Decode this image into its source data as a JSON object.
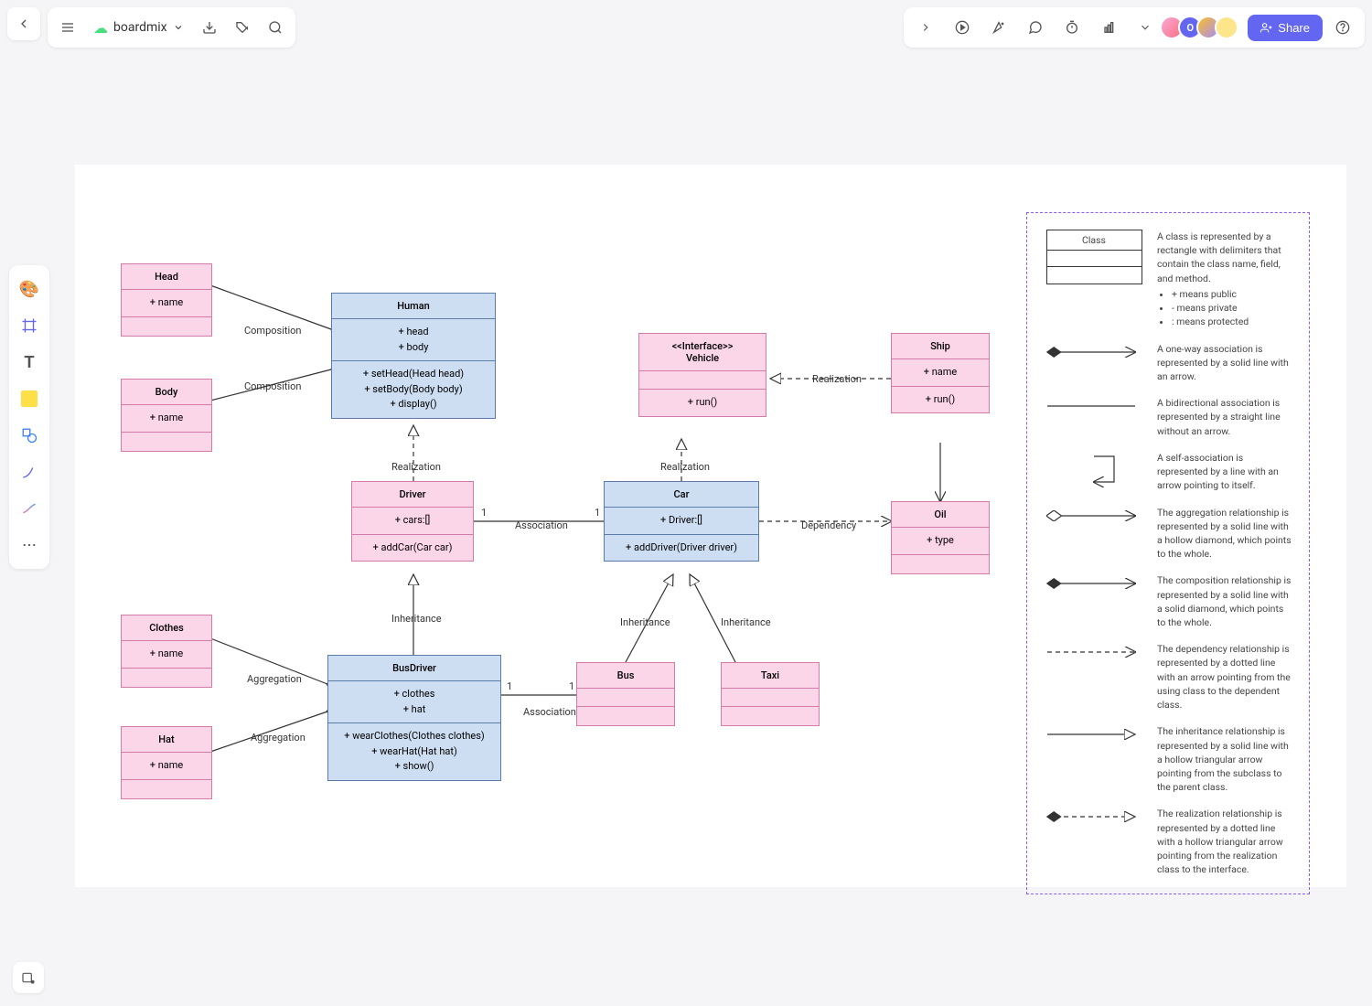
{
  "header": {
    "doc_title": "boardmix",
    "share_label": "Share",
    "avatar_letter": "O"
  },
  "classes": {
    "head": {
      "title": "Head",
      "attrs": [
        "+ name"
      ]
    },
    "body": {
      "title": "Body",
      "attrs": [
        "+ name"
      ]
    },
    "human": {
      "title": "Human",
      "attrs": [
        "+ head",
        "+ body"
      ],
      "ops": [
        "+ setHead(Head head)",
        "+ setBody(Body body)",
        "+ display()"
      ]
    },
    "driver": {
      "title": "Driver",
      "attrs": [
        "+ cars:[]"
      ],
      "ops": [
        "+ addCar(Car car)"
      ]
    },
    "busdriver": {
      "title": "BusDriver",
      "attrs": [
        "+ clothes",
        "+ hat"
      ],
      "ops": [
        "+ wearClothes(Clothes clothes)",
        "+ wearHat(Hat hat)",
        "+ show()"
      ]
    },
    "clothes": {
      "title": "Clothes",
      "attrs": [
        "+ name"
      ]
    },
    "hat": {
      "title": "Hat",
      "attrs": [
        "+ name"
      ]
    },
    "vehicle": {
      "stereo": "<<Interface>>",
      "title": "Vehicle",
      "ops": [
        "+ run()"
      ]
    },
    "car": {
      "title": "Car",
      "attrs": [
        "+ Driver:[]"
      ],
      "ops": [
        "+ addDriver(Driver driver)"
      ]
    },
    "bus": {
      "title": "Bus"
    },
    "taxi": {
      "title": "Taxi"
    },
    "ship": {
      "title": "Ship",
      "attrs": [
        "+ name"
      ],
      "ops": [
        "+ run()"
      ]
    },
    "oil": {
      "title": "Oil",
      "attrs": [
        "+ type"
      ]
    }
  },
  "edges": {
    "composition1": "Composition",
    "composition2": "Composition",
    "realization1": "Realization",
    "realization2": "Realization",
    "realization3": "Realization",
    "association1": "Association",
    "association2": "Association",
    "dependency": "Dependency",
    "inheritance1": "Inheritance",
    "inheritance2": "Inheritance",
    "inheritance3": "Inheritance",
    "aggregation1": "Aggregation",
    "aggregation2": "Aggregation",
    "mult1": "1",
    "mult2": "1",
    "mult3": "1",
    "mult4": "1"
  },
  "legend": {
    "class_title": "Class",
    "class_desc": "A class is represented by a rectangle with delimiters that contain the class name, field, and method.",
    "bullets": [
      "+ means public",
      "- means private",
      ": means protected"
    ],
    "rows": [
      "A one-way association is represented by a solid line with an arrow.",
      "A bidirectional association is represented by a straight line without an arrow.",
      "A self-association is represented by a line with an arrow pointing to itself.",
      "The aggregation relationship is represented by a solid line with a hollow diamond, which points to the whole.",
      "The composition relationship is represented by a solid line with a solid diamond, which points to the whole.",
      "The dependency relationship is represented by a dotted line with an arrow pointing from the using class to the dependent class.",
      "The inheritance relationship is represented by a solid line with a hollow triangular arrow pointing from the subclass to the parent class.",
      "The realization relationship is represented by a dotted line with a hollow triangular arrow pointing from the realization class to the interface."
    ]
  }
}
